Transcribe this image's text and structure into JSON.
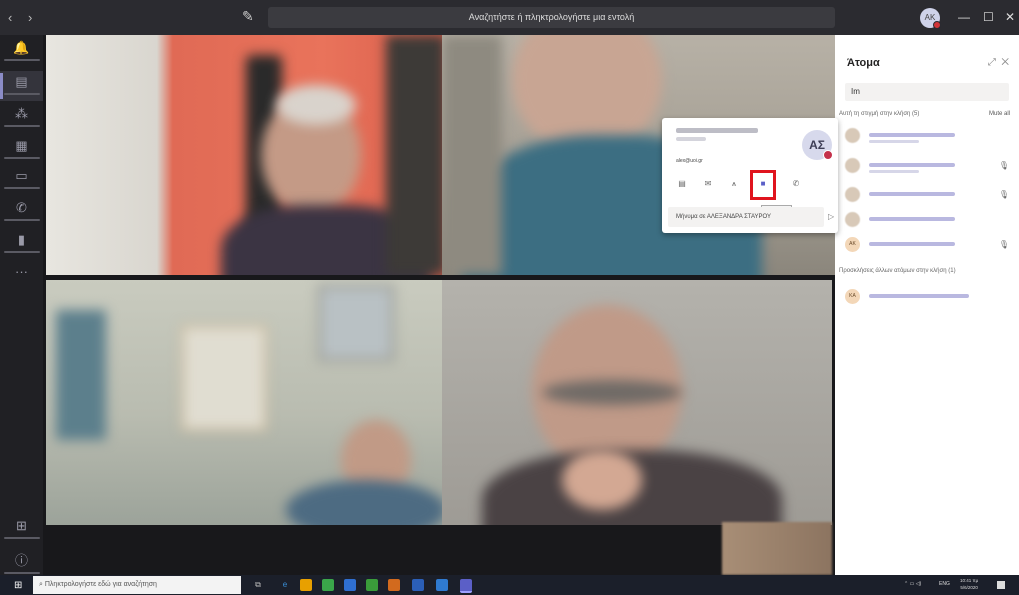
{
  "titlebar": {
    "back_forward": "‹ ›",
    "compose_icon": "✎",
    "search_placeholder": "Αναζητήστε ή πληκτρολογήστε μια εντολή",
    "avatar_initials": "AK",
    "minimize": "—",
    "maximize": "☐",
    "close": "✕"
  },
  "rail": {
    "items": [
      {
        "icon": "bell-icon",
        "glyph": "🔔"
      },
      {
        "icon": "chat-icon",
        "glyph": "▤"
      },
      {
        "icon": "teams-icon",
        "glyph": "⁂"
      },
      {
        "icon": "assignments-icon",
        "glyph": "▦"
      },
      {
        "icon": "calendar-icon",
        "glyph": "▭"
      },
      {
        "icon": "calls-icon",
        "glyph": "✆"
      },
      {
        "icon": "files-icon",
        "glyph": "▮"
      },
      {
        "icon": "more-icon",
        "glyph": "···"
      }
    ],
    "apps_glyph": "⊞",
    "help_glyph": "ⓘ"
  },
  "panel": {
    "title": "Άτομα",
    "search_value": "Im",
    "in_call_section": "Αυτή τη στιγμή στην κλήση (5)",
    "mute_all": "Mute all",
    "others_section": "Προσκλήσεις άλλων ατόμων στην κλήση (1)",
    "participant_initials": [
      "AK",
      "KA"
    ]
  },
  "card": {
    "email": "alex@uoi.gr",
    "avatar_initials": "ΑΣ",
    "message_placeholder": "Μήνυμα σε ΑΛΕΞΑΝΔΡΑ ΣΤΑΥΡΟΥ",
    "tooltip": "Κλήση βίντεο",
    "send_glyph": "▷"
  },
  "taskbar": {
    "start_glyph": "⊞",
    "search_placeholder": "Πληκτρολογήστε εδώ για αναζήτηση",
    "tray_lang": "ENG",
    "clock_time": "10:41 πμ",
    "clock_date": "5/6/2020"
  },
  "colors": {
    "teams_purple": "#8b8cc7",
    "highlight_red": "#e0141e",
    "presence_busy": "#c4314b"
  }
}
